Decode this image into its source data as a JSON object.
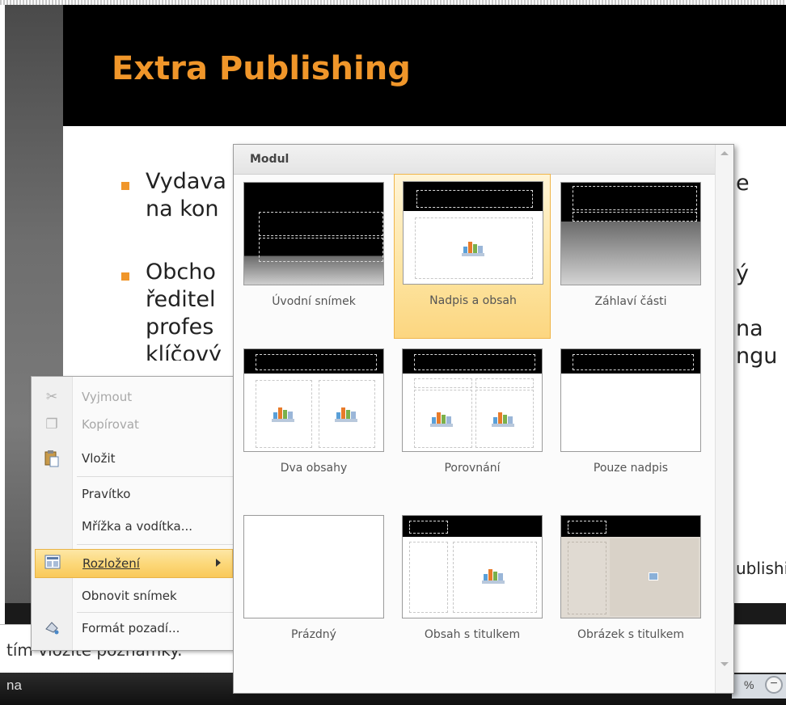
{
  "slide": {
    "title": "Extra Publishing",
    "bullets": [
      {
        "lines": [
          "Vydava",
          "na kon"
        ]
      },
      {
        "lines": [
          "Obcho",
          "ředitel",
          "profes",
          "klíčový"
        ]
      }
    ],
    "right_fragments": [
      "e",
      "ý",
      "na",
      "ngu",
      "ublishi"
    ]
  },
  "notes": {
    "text": "tím vložíte poznámky."
  },
  "status_bar": {
    "left_text": "na",
    "zoom_label": "%",
    "zoom_minus": "−"
  },
  "context_menu": {
    "items": [
      {
        "label": "Vyjmout",
        "icon": "scissors-icon",
        "disabled": true
      },
      {
        "label": "Kopírovat",
        "icon": "copy-icon",
        "disabled": true
      },
      {
        "label": "Vložit",
        "icon": "paste-icon",
        "disabled": false
      },
      {
        "label": "Pravítko",
        "icon": "",
        "disabled": false
      },
      {
        "label": "Mřížka a vodítka...",
        "icon": "",
        "disabled": false
      },
      {
        "label": "Rozložení",
        "icon": "layout-icon",
        "disabled": false,
        "submenu": true,
        "highlighted": true
      },
      {
        "label": "Obnovit snímek",
        "icon": "",
        "disabled": false
      },
      {
        "label": "Formát pozadí...",
        "icon": "format-background-icon",
        "disabled": false
      }
    ]
  },
  "layout_gallery": {
    "header": "Modul",
    "selected": "Nadpis a obsah",
    "layouts": [
      {
        "label": "Úvodní snímek"
      },
      {
        "label": "Nadpis a obsah"
      },
      {
        "label": "Záhlaví části"
      },
      {
        "label": "Dva obsahy"
      },
      {
        "label": "Porovnání"
      },
      {
        "label": "Pouze nadpis"
      },
      {
        "label": "Prázdný"
      },
      {
        "label": "Obsah s titulkem"
      },
      {
        "label": "Obrázek s titulkem"
      }
    ]
  },
  "colors": {
    "accent": "#f0962a",
    "highlight": "#fcd87a",
    "slide_header": "#000000"
  }
}
